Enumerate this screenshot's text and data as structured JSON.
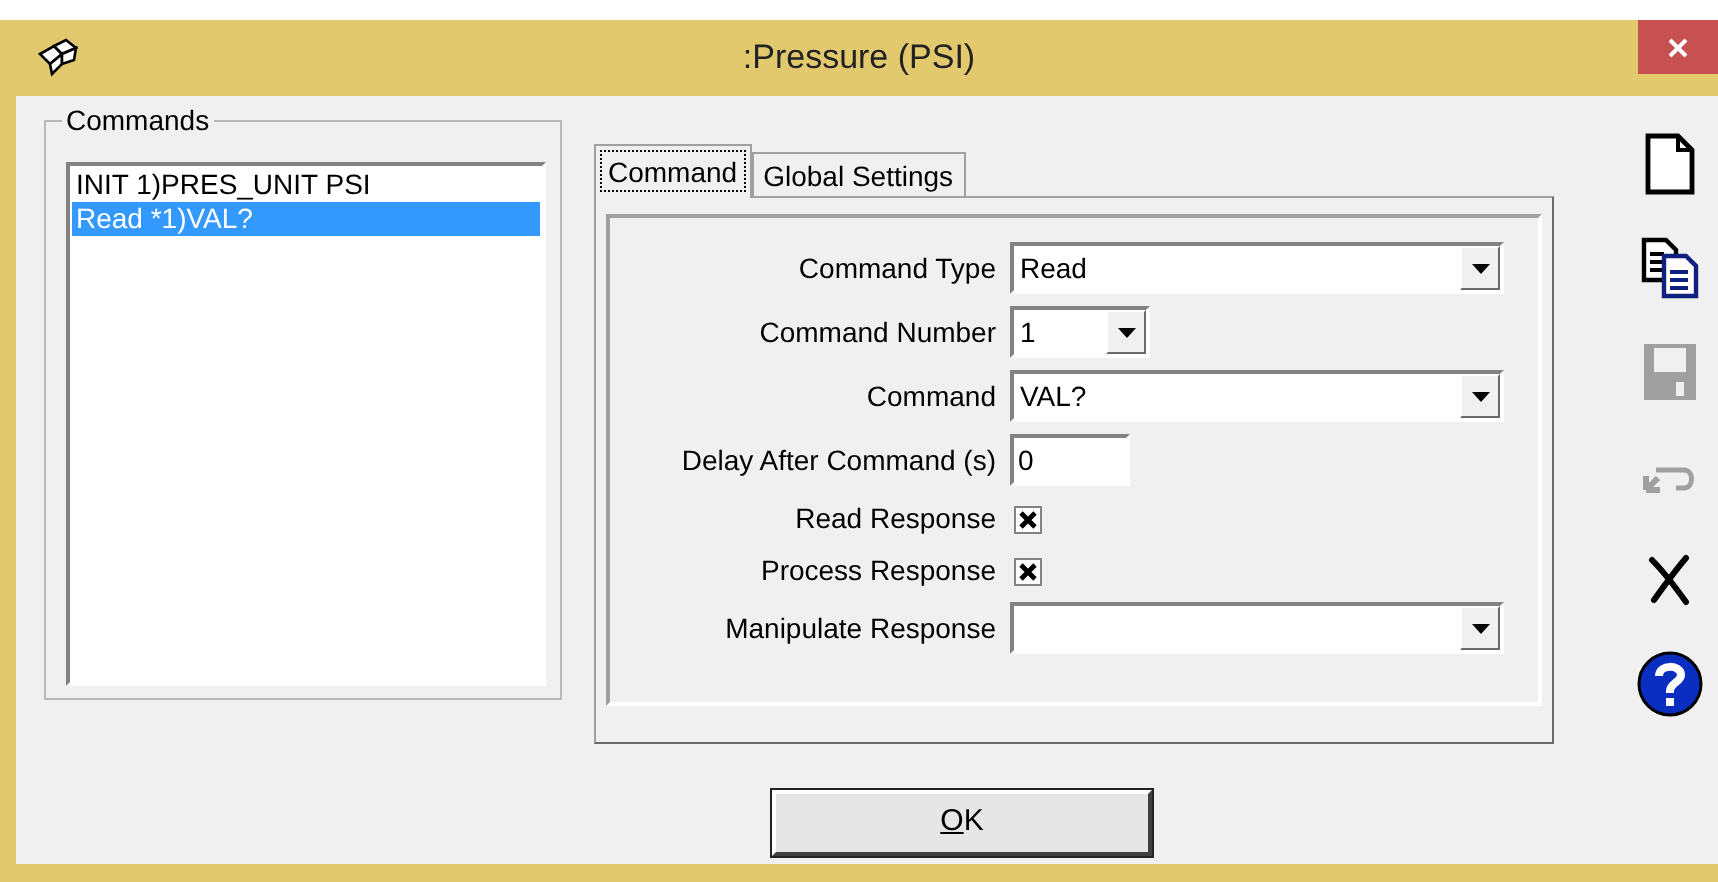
{
  "window": {
    "title": ":Pressure (PSI)"
  },
  "commands": {
    "label": "Commands",
    "items": [
      {
        "text": "INIT 1)PRES_UNIT PSI",
        "selected": false
      },
      {
        "text": "Read *1)VAL?",
        "selected": true
      }
    ]
  },
  "tabs": [
    {
      "label": "Command",
      "selected": true
    },
    {
      "label": "Global Settings",
      "selected": false
    }
  ],
  "fields": [
    {
      "kind": "combo",
      "label": "Command Type",
      "value": "Read"
    },
    {
      "kind": "combo-short",
      "label": "Command Number",
      "value": "1"
    },
    {
      "kind": "combo",
      "label": "Command",
      "value": "VAL?"
    },
    {
      "kind": "text",
      "label": "Delay After Command (s)",
      "value": "0"
    },
    {
      "kind": "checkbox",
      "label": "Read Response",
      "checked": true
    },
    {
      "kind": "checkbox",
      "label": "Process Response",
      "checked": true
    },
    {
      "kind": "combo",
      "label": "Manipulate Response"
    }
  ],
  "toolbar": [
    {
      "kind": "new",
      "disabled": false
    },
    {
      "kind": "copy",
      "disabled": false
    },
    {
      "kind": "save",
      "disabled": true
    },
    {
      "kind": "undo",
      "disabled": true
    },
    {
      "kind": "delete",
      "disabled": false
    },
    {
      "kind": "help",
      "disabled": false
    }
  ],
  "buttons": [
    {
      "label": "OK"
    }
  ]
}
